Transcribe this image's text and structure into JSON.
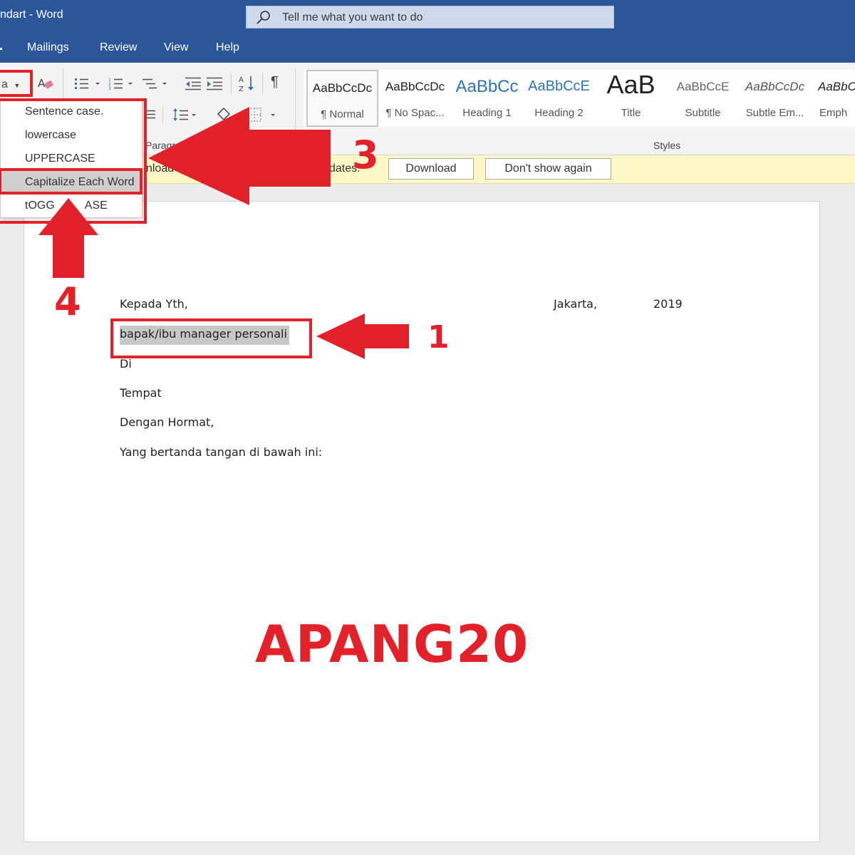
{
  "title_bar": {
    "app_title": "ndart  -  Word",
    "tell_me": "Tell me what you want to do"
  },
  "tabs": [
    "Mailings",
    "Review",
    "View",
    "Help"
  ],
  "ribbon": {
    "change_case_label": "a",
    "paragraph_group": "Paragra",
    "styles_group": "Styles",
    "styles": [
      {
        "sample": "AaBbCcDc",
        "name": "¶ Normal"
      },
      {
        "sample": "AaBbCcDc",
        "name": "¶ No Spac..."
      },
      {
        "sample": "AaBbCc",
        "name": "Heading 1"
      },
      {
        "sample": "AaBbCcE",
        "name": "Heading 2"
      },
      {
        "sample": "AaB",
        "name": "Title"
      },
      {
        "sample": "AaBbCcE",
        "name": "Subtitle"
      },
      {
        "sample": "AaBbCcDc",
        "name": "Subtle Em..."
      },
      {
        "sample": "AaBbC",
        "name": "Emph"
      }
    ]
  },
  "message_bar": {
    "text_left": "nload",
    "text_right": "dates.",
    "download_button": "Download",
    "dont_show_button": "Don't show again"
  },
  "change_case_menu": {
    "items": [
      "Sentence case.",
      "lowercase",
      "UPPERCASE",
      "Capitalize Each Word",
      "tOGG",
      "ASE"
    ],
    "highlighted": "Capitalize Each Word"
  },
  "document": {
    "line1_left": "Kepada Yth,",
    "line1_place": "Jakarta,",
    "line1_year": "2019",
    "selected_text": "bapak/ibu manager personali",
    "line3": "Di",
    "line4": "Tempat",
    "line5": "Dengan Hormat,",
    "line6": "Yang bertanda tangan di bawah ini:"
  },
  "annotations": {
    "step1": "1",
    "step3": "3",
    "step4": "4",
    "watermark": "APANG20",
    "color": "#e3212b"
  }
}
